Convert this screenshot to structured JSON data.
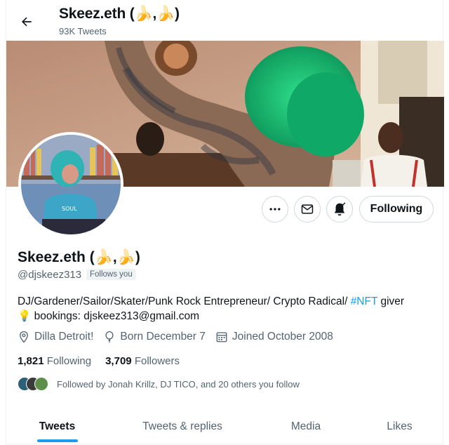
{
  "header": {
    "title": "Skeez.eth (🍌,🍌)",
    "tweet_count": "93K Tweets"
  },
  "profile": {
    "display_name": "Skeez.eth (🍌,🍌)",
    "handle": "@djskeez313",
    "follows_you": "Follows you",
    "bio_text": "DJ/Gardener/Sailor/Skater/Punk Rock Entrepreneur/ Crypto Radical/ ",
    "bio_hashtag": "#NFT",
    "bio_after_tag": " giver",
    "bio_line2": "💡 bookings: djskeez313@gmail.com",
    "location": "Dilla Detroit!",
    "birthday": "Born December 7",
    "joined": "Joined October 2008",
    "following_count": "1,821",
    "following_label": "Following",
    "followers_count": "3,709",
    "followers_label": "Followers",
    "followed_by": "Followed by Jonah Krillz, DJ TICO, and 20 others you follow"
  },
  "actions": {
    "follow_button": "Following",
    "more_icon": "more-icon",
    "message_icon": "envelope-icon",
    "notify_icon": "bell-icon"
  },
  "tabs": [
    {
      "label": "Tweets",
      "active": true
    },
    {
      "label": "Tweets & replies",
      "active": false
    },
    {
      "label": "Media",
      "active": false
    },
    {
      "label": "Likes",
      "active": false
    }
  ],
  "colors": {
    "accent": "#1d9bf0",
    "secondary_text": "#536471",
    "primary_text": "#0f1419",
    "border": "#cfd9de"
  }
}
